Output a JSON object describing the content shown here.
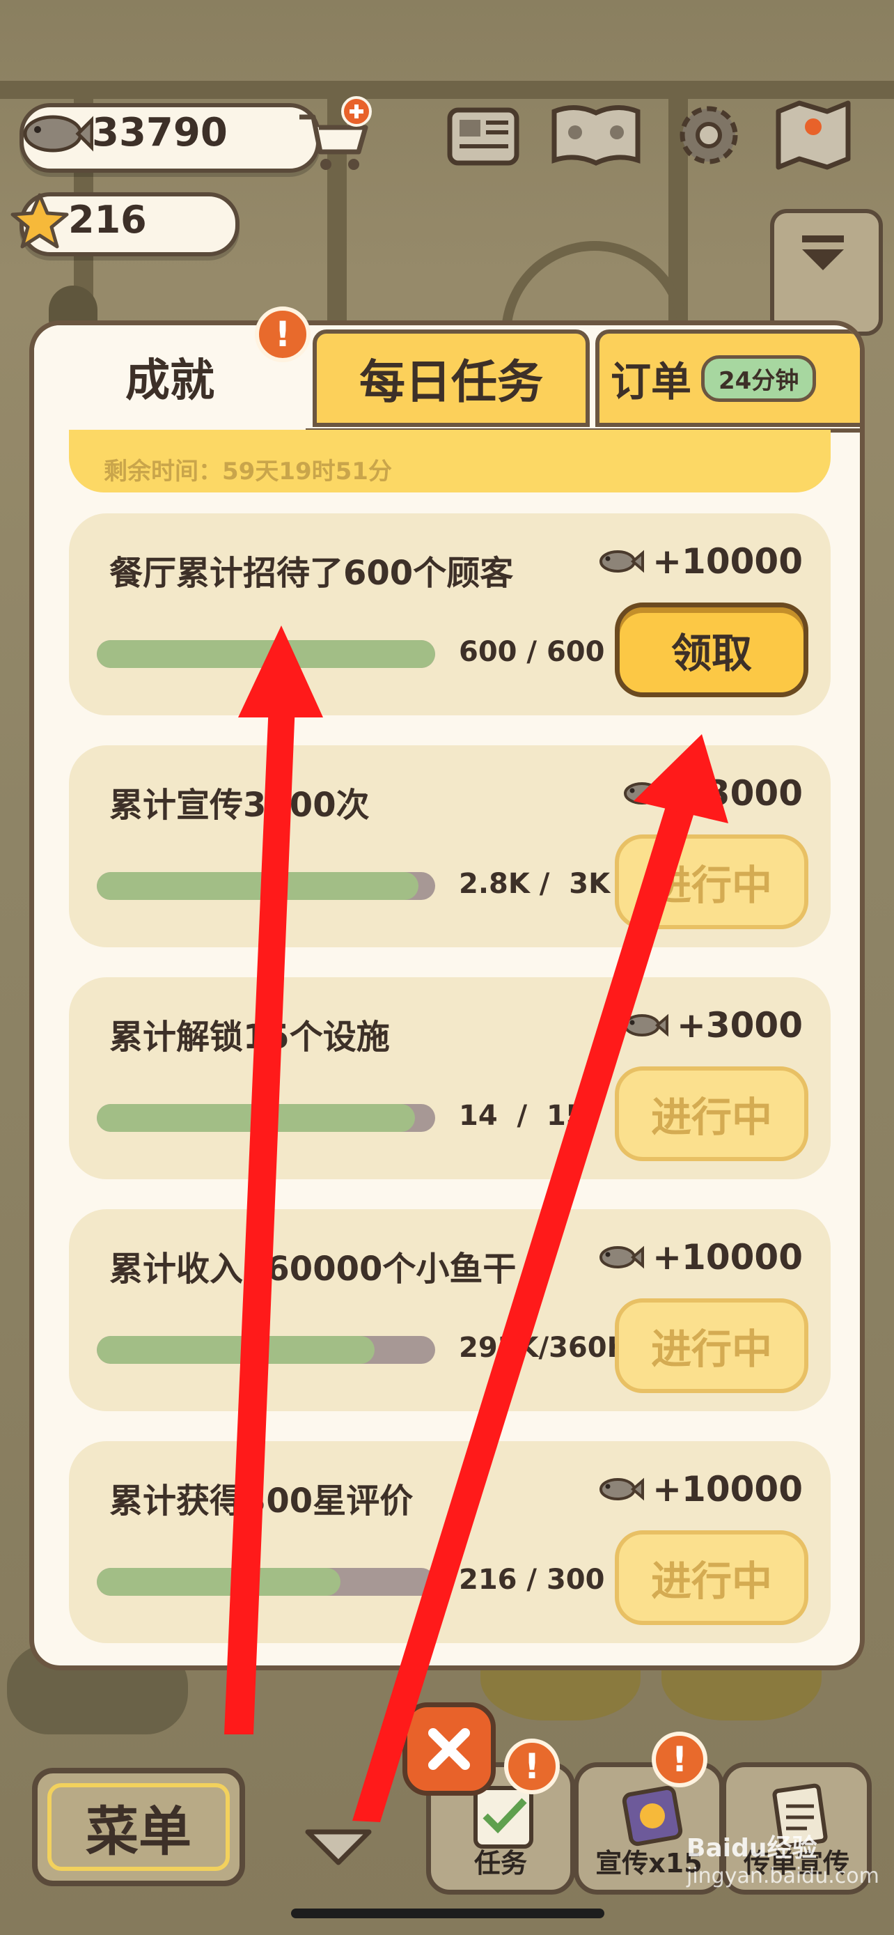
{
  "hud": {
    "coins": "33790",
    "stars": "216",
    "coin_icon": "fish-icon",
    "star_icon": "star-icon",
    "shop_icon": "cart-icon"
  },
  "top_buttons": [
    "newspaper-icon",
    "pawbook-icon",
    "gear-icon",
    "map-icon"
  ],
  "tabs": {
    "achievements": "成就",
    "daily": "每日任务",
    "orders": "订单",
    "orders_timer": "24分钟",
    "achievements_badge": "!"
  },
  "partial": {
    "time_left": "剩余时间：59天19时51分"
  },
  "achievements": [
    {
      "title": "餐厅累计招待了600个顾客",
      "reward": "+10000",
      "progress": "600 / 600",
      "fill": 1.0,
      "button": "领取",
      "state": "claim"
    },
    {
      "title": "累计宣传3000次",
      "reward": "+3000",
      "progress": "2.8K /  3K",
      "fill": 0.95,
      "button": "进行中",
      "state": "progress"
    },
    {
      "title": "累计解锁15个设施",
      "reward": "+3000",
      "progress": "14  /  15",
      "fill": 0.94,
      "button": "进行中",
      "state": "progress"
    },
    {
      "title": "累计收入360000个小鱼干",
      "reward": "+10000",
      "progress": "293K/360K",
      "fill": 0.82,
      "button": "进行中",
      "state": "progress"
    },
    {
      "title": "累计获得300星评价",
      "reward": "+10000",
      "progress": "216 / 300",
      "fill": 0.72,
      "button": "进行中",
      "state": "progress"
    }
  ],
  "bottom": {
    "menu": "菜单",
    "tasks": "任务",
    "promo": "宣传x15",
    "flyer": "传单宣传"
  },
  "watermark": {
    "brand": "Baidu经验",
    "url": "jingyan.baidu.com"
  },
  "colors": {
    "panel_border": "#6b5641",
    "claim_button": "#fcc845",
    "progress_fill": "#a2be86",
    "arrow": "#ff1a1a"
  }
}
